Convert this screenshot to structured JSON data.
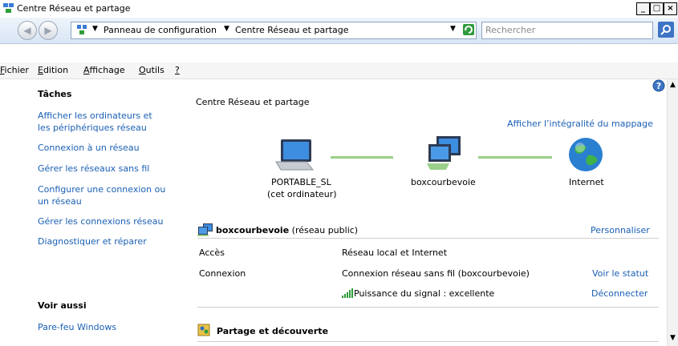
{
  "window": {
    "title": "Centre Réseau et partage"
  },
  "address": {
    "breadcrumb_1": "Panneau de configuration",
    "breadcrumb_2": "Centre Réseau et partage",
    "search_placeholder": "Rechercher"
  },
  "menu": {
    "file_first": "F",
    "file_rest": "ichier",
    "edit_first": "E",
    "edit_rest": "dition",
    "view_first": "A",
    "view_rest": "ffichage",
    "tools_first": "O",
    "tools_rest": "utils",
    "help": "?"
  },
  "tasks": {
    "heading": "Tâches",
    "links": [
      "Afficher les ordinateurs et les périphériques réseau",
      "Connexion à un réseau",
      "Gérer les réseaux sans fil",
      "Configurer une connexion ou un réseau",
      "Gérer les connexions réseau",
      "Diagnostiquer et réparer"
    ]
  },
  "see_also": {
    "heading": "Voir aussi",
    "links": [
      "Pare-feu Windows"
    ]
  },
  "main": {
    "page_title": "Centre Réseau et partage",
    "full_map_link": "Afficher l’intégralité du mappage",
    "map": {
      "computer_name": "PORTABLE_SL",
      "computer_sub": "(cet ordinateur)",
      "network_name": "boxcourbevoie",
      "internet": "Internet"
    },
    "network": {
      "name": "boxcourbevoie",
      "type": "(réseau public)",
      "customize": "Personnaliser",
      "rows": [
        {
          "label": "Accès",
          "value": "Réseau local et Internet",
          "action": ""
        },
        {
          "label": "Connexion",
          "value": "Connexion réseau sans fil (boxcourbevoie)",
          "action": "Voir le statut"
        },
        {
          "label": "",
          "value": "Puissance du signal : excellente",
          "action": "Déconnecter"
        }
      ]
    },
    "sharing": {
      "title": "Partage et découverte"
    }
  },
  "colors": {
    "link": "#1a5fb4",
    "line": "#9ad08a"
  },
  "icons": {
    "back": "back-arrow-icon",
    "forward": "forward-arrow-icon",
    "refresh": "refresh-icon",
    "search": "search-icon",
    "help": "help-icon",
    "computer": "computer-icon",
    "network": "network-icon",
    "globe": "globe-icon",
    "signal": "signal-strength-icon",
    "sharing": "sharing-icon"
  }
}
